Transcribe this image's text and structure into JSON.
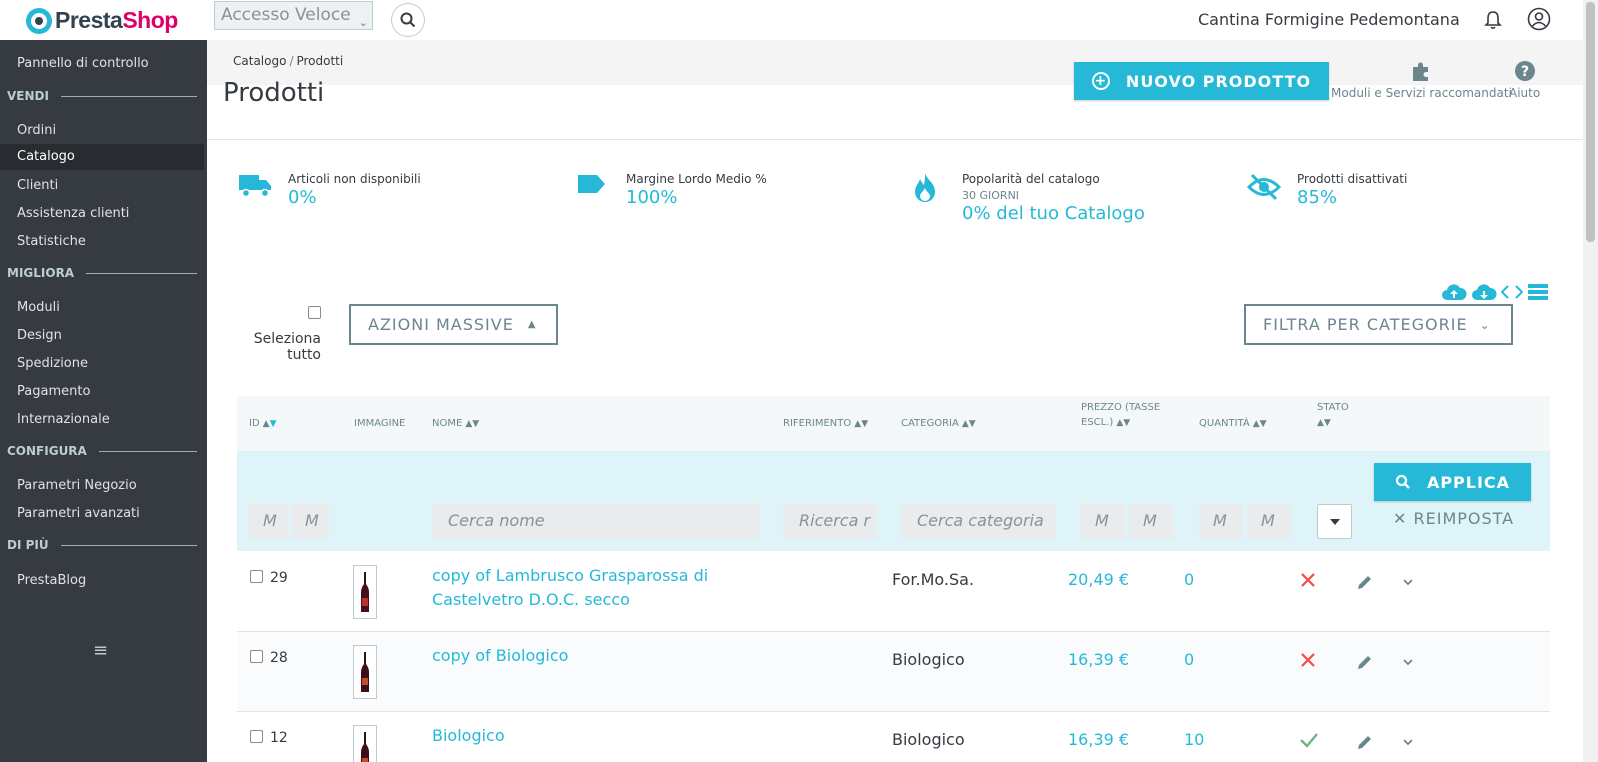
{
  "header": {
    "logo_part1": "Presta",
    "logo_part2": "Shop",
    "quick_access": "Accesso Veloce",
    "shop_name": "Cantina Formigine Pedemontana"
  },
  "sidebar": {
    "dashboard": "Pannello di controllo",
    "sections": [
      {
        "title": "VENDI",
        "items": [
          "Ordini",
          "Catalogo",
          "Clienti",
          "Assistenza clienti",
          "Statistiche"
        ]
      },
      {
        "title": "MIGLIORA",
        "items": [
          "Moduli",
          "Design",
          "Spedizione",
          "Pagamento",
          "Internazionale"
        ]
      },
      {
        "title": "CONFIGURA",
        "items": [
          "Parametri Negozio",
          "Parametri avanzati"
        ]
      },
      {
        "title": "DI PIÙ",
        "items": [
          "PrestaBlog"
        ]
      }
    ],
    "active_item": "Catalogo"
  },
  "page": {
    "breadcrumb": [
      "Catalogo",
      "Prodotti"
    ],
    "breadcrumb_sep": "/",
    "title": "Prodotti",
    "new_product": "NUOVO PRODOTTO",
    "modules_link": "Moduli e Servizi raccomandati",
    "help_link": "Aiuto"
  },
  "kpis": [
    {
      "title": "Articoli non disponibili",
      "value": "0%"
    },
    {
      "title": "Margine Lordo Medio %",
      "value": "100%"
    },
    {
      "title": "Popolarità del catalogo",
      "sub": "30 GIORNI",
      "value": "0% del tuo Catalogo"
    },
    {
      "title": "Prodotti disattivati",
      "value": "85%"
    }
  ],
  "controls": {
    "select_all": [
      "Seleziona",
      "tutto"
    ],
    "bulk_actions": "AZIONI MASSIVE",
    "filter_categories": "FILTRA PER CATEGORIE",
    "apply": "APPLICA",
    "reset": "REIMPOSTA"
  },
  "table": {
    "columns": [
      "ID",
      "IMMAGINE",
      "NOME",
      "RIFERIMENTO",
      "CATEGORIA",
      "PREZZO (TASSE",
      "ESCL.)",
      "QUANTITÀ",
      "STATO"
    ],
    "filters": {
      "id_min": "M",
      "id_max": "M",
      "name": "Cerca nome",
      "reference": "Ricerca r",
      "category": "Cerca categoria",
      "price_min": "M",
      "price_max": "M",
      "qty_min": "M",
      "qty_max": "M"
    },
    "rows": [
      {
        "id": "29",
        "name": "copy of Lambrusco Grasparossa di Castelvetro D.O.C. secco",
        "category": "For.Mo.Sa.",
        "price": "20,49 €",
        "qty": "0",
        "active": false
      },
      {
        "id": "28",
        "name": "copy of Biologico",
        "category": "Biologico",
        "price": "16,39 €",
        "qty": "0",
        "active": false
      },
      {
        "id": "12",
        "name": "Biologico",
        "category": "Biologico",
        "price": "16,39 €",
        "qty": "10",
        "active": true
      }
    ]
  },
  "colors": {
    "accent": "#25b9d7",
    "sidebar": "#363a41",
    "danger": "#f54c3e",
    "success": "#70b580"
  }
}
